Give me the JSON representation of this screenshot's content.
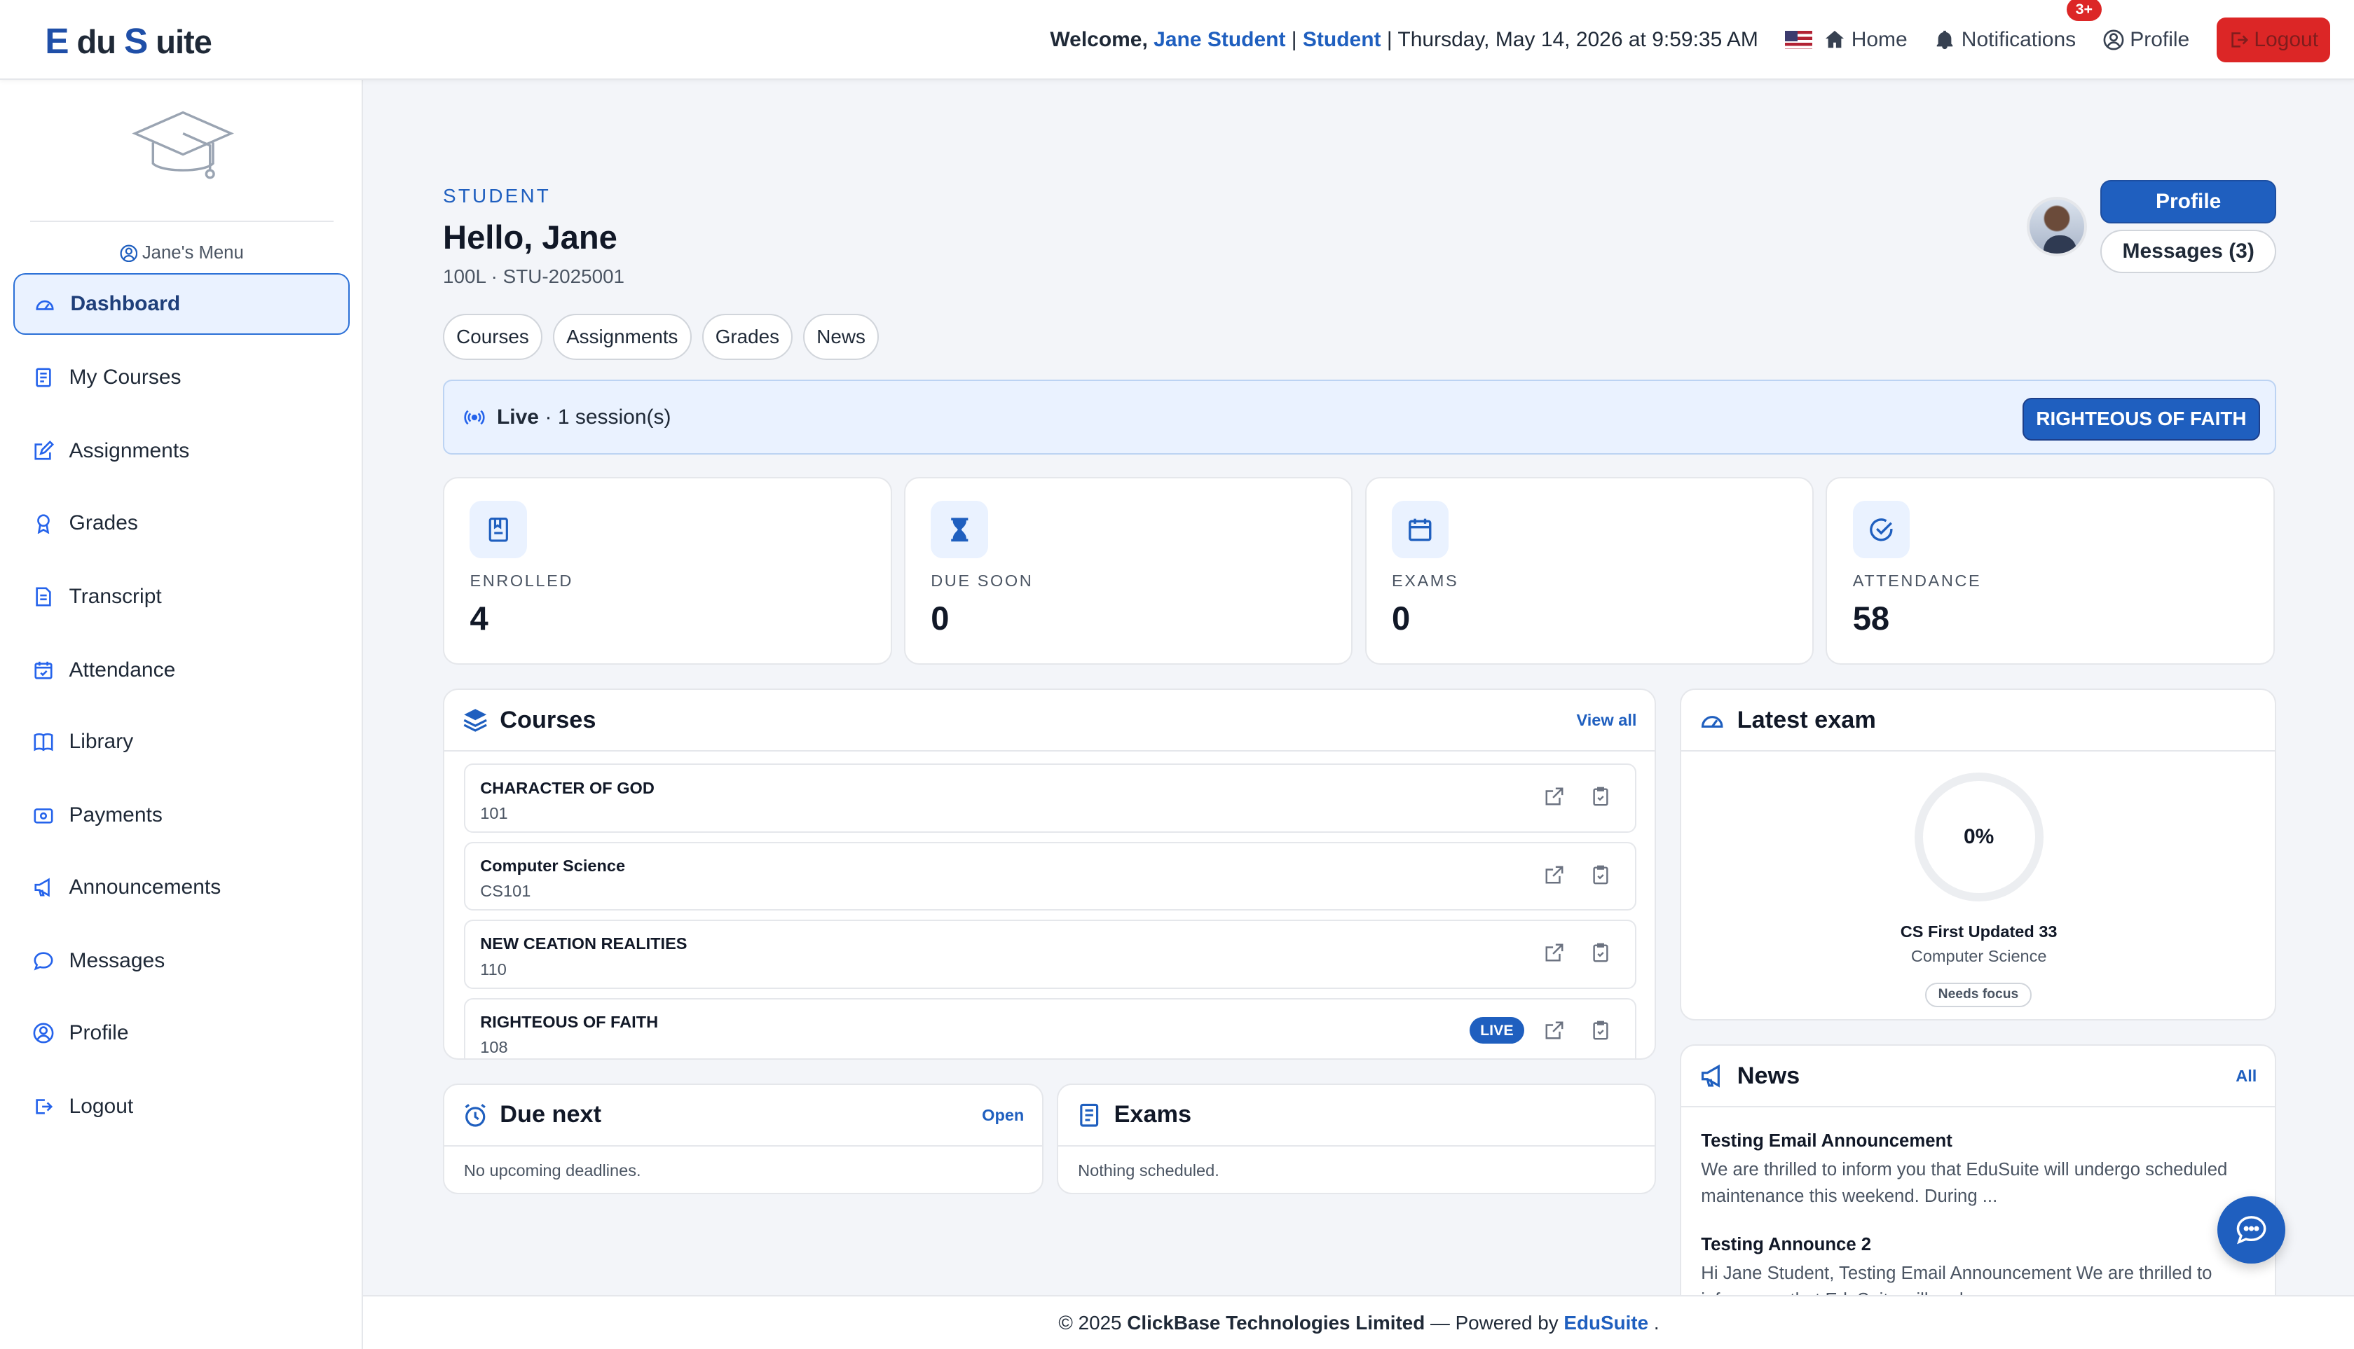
{
  "brand": {
    "logo_e": "E",
    "logo_du": "du",
    "logo_s": "S",
    "logo_uite": "uite"
  },
  "header": {
    "welcome_label": "Welcome,",
    "user_name": "Jane Student",
    "role": "Student",
    "datetime": "Thursday, May 14, 2026 at 9:59:35 AM",
    "home": "Home",
    "notifications": "Notifications",
    "notifications_badge": "3+",
    "profile": "Profile",
    "logout": "Logout"
  },
  "sidebar": {
    "menu_title": "Jane's Menu",
    "items": [
      {
        "label": "Dashboard",
        "icon": "gauge-icon"
      },
      {
        "label": "My Courses",
        "icon": "journal-icon"
      },
      {
        "label": "Assignments",
        "icon": "pencil-square-icon"
      },
      {
        "label": "Grades",
        "icon": "award-icon"
      },
      {
        "label": "Transcript",
        "icon": "file-text-icon"
      },
      {
        "label": "Attendance",
        "icon": "calendar-check-icon"
      },
      {
        "label": "Library",
        "icon": "book-icon"
      },
      {
        "label": "Payments",
        "icon": "wallet-icon"
      },
      {
        "label": "Announcements",
        "icon": "megaphone-icon"
      },
      {
        "label": "Messages",
        "icon": "chat-icon"
      },
      {
        "label": "Profile",
        "icon": "person-circle-icon"
      },
      {
        "label": "Logout",
        "icon": "box-arrow-right-icon"
      }
    ]
  },
  "hero": {
    "eyebrow": "STUDENT",
    "greeting": "Hello, Jane",
    "subline": "100L · STU-2025001",
    "profile_button": "Profile",
    "messages_button": "Messages (3)",
    "chips": [
      "Courses",
      "Assignments",
      "Grades",
      "News"
    ]
  },
  "live": {
    "label": "Live",
    "sessions": "· 1 session(s)",
    "course_tag": "RIGHTEOUS OF FAITH"
  },
  "stats": [
    {
      "label": "ENROLLED",
      "value": "4",
      "icon": "journal-bookmark-icon"
    },
    {
      "label": "DUE SOON",
      "value": "0",
      "icon": "hourglass-icon"
    },
    {
      "label": "EXAMS",
      "value": "0",
      "icon": "calendar-icon"
    },
    {
      "label": "ATTENDANCE",
      "value": "58",
      "icon": "check-circle-icon"
    }
  ],
  "courses": {
    "title": "Courses",
    "view_all": "View all",
    "live_pill": "LIVE",
    "items": [
      {
        "name": "CHARACTER OF GOD",
        "code": "101",
        "live": false
      },
      {
        "name": "Computer Science",
        "code": "CS101",
        "live": false
      },
      {
        "name": "NEW CEATION REALITIES",
        "code": "110",
        "live": false
      },
      {
        "name": "RIGHTEOUS OF FAITH",
        "code": "108",
        "live": true
      }
    ]
  },
  "latest_exam": {
    "title": "Latest exam",
    "score": "0%",
    "exam_name": "CS First Updated 33",
    "course": "Computer Science",
    "status": "Needs focus"
  },
  "due_next": {
    "title": "Due next",
    "link": "Open",
    "empty": "No upcoming deadlines."
  },
  "exams": {
    "title": "Exams",
    "empty": "Nothing scheduled."
  },
  "news": {
    "title": "News",
    "link": "All",
    "items": [
      {
        "title": "Testing Email Announcement",
        "body": "We are thrilled to inform you that EduSuite will undergo scheduled maintenance this weekend. During ..."
      },
      {
        "title": "Testing Announce 2",
        "body": "Hi Jane Student, Testing Email Announcement We are thrilled to inform you that EduSuite will undergo"
      }
    ]
  },
  "footer": {
    "copyright": "© 2025",
    "company": "ClickBase Technologies Limited",
    "powered": "— Powered by",
    "product": "EduSuite",
    "end": "."
  },
  "colors": {
    "primary": "#1f5fbf",
    "danger": "#dc2626",
    "page_bg": "#f3f5f9"
  }
}
